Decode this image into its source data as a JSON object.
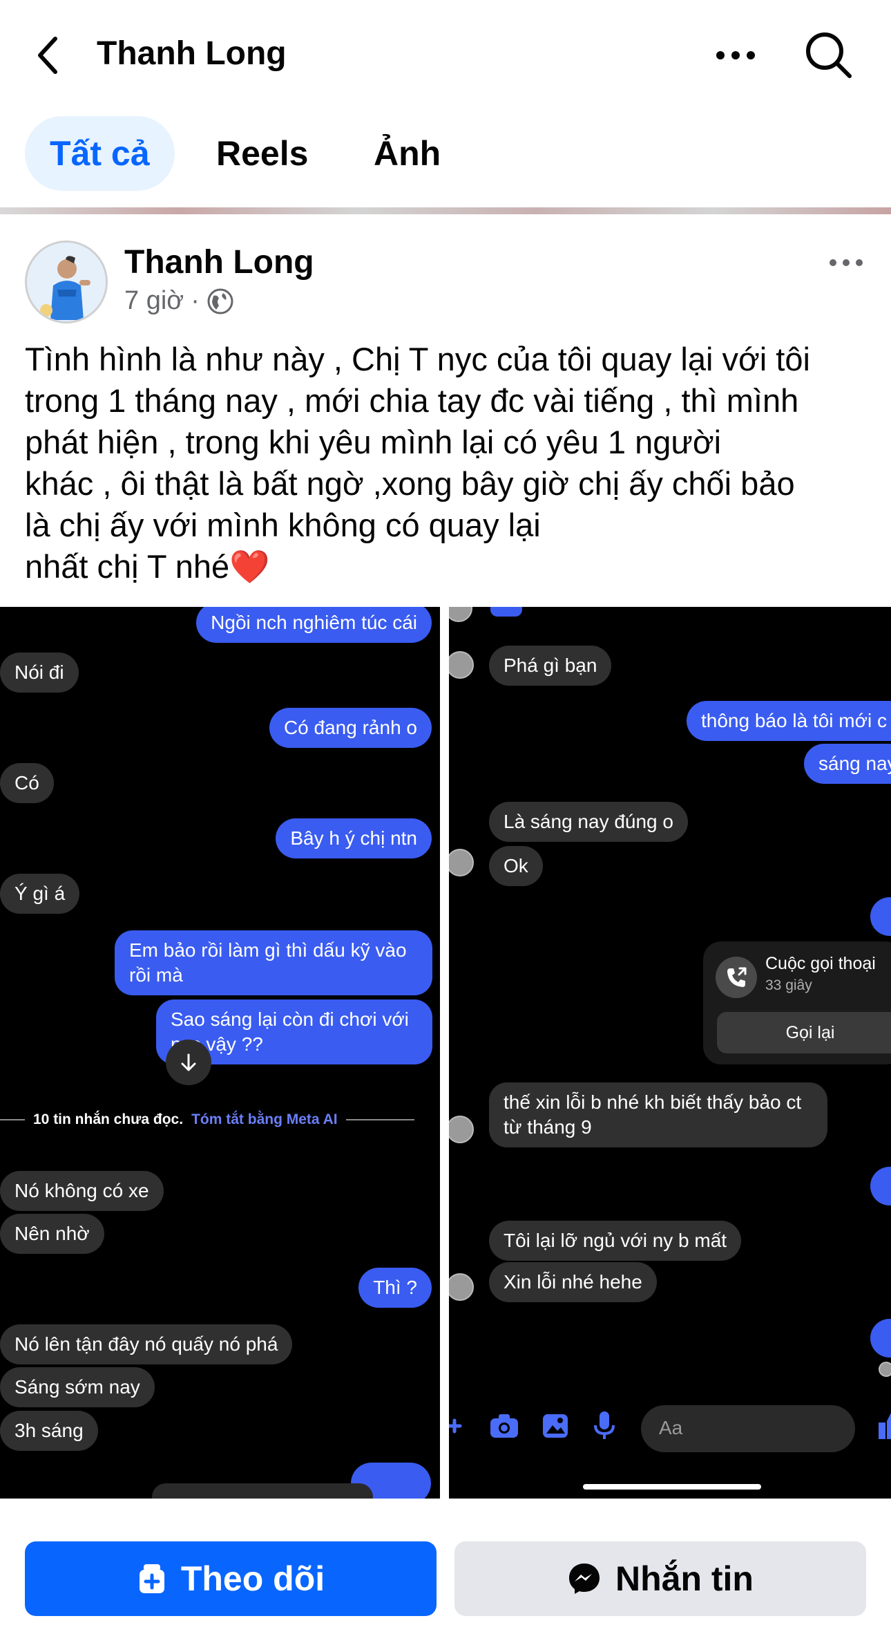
{
  "header": {
    "title": "Thanh Long"
  },
  "tabs": [
    {
      "label": "Tất cả",
      "active": true
    },
    {
      "label": "Reels",
      "active": false
    },
    {
      "label": "Ảnh",
      "active": false
    }
  ],
  "post": {
    "author": "Thanh Long",
    "time": "7 giờ",
    "separator": "·",
    "privacy_icon": "globe-icon",
    "text_lines": [
      "Tình hình là như này , Chị T nyc của tôi quay lại với tôi",
      "trong 1 tháng nay , mới chia tay đc vài tiếng , thì mình",
      "phát hiện , trong khi yêu mình lại có yêu 1 người",
      "khác , ôi thật là bất ngờ ,xong bây giờ chị ấy chối bảo",
      "là chị ấy với mình không có quay lại",
      "nhất chị T nhé❤️"
    ]
  },
  "chat_left": {
    "messages": [
      {
        "dir": "out",
        "text": "Ngồi nch nghiêm túc cái"
      },
      {
        "dir": "in",
        "text": "Nói đi"
      },
      {
        "dir": "out",
        "text": "Có đang rảnh o"
      },
      {
        "dir": "in",
        "text": "Có"
      },
      {
        "dir": "out",
        "text": "Bây h ý chị ntn"
      },
      {
        "dir": "in",
        "text": "Ý gì á"
      },
      {
        "dir": "out",
        "text": "Em bảo rồi làm gì thì dấu kỹ vào rồi mà"
      },
      {
        "dir": "out",
        "text": "Sao sáng lại còn đi chơi với nyc vậy ??"
      },
      {
        "dir": "in",
        "text": "Nó không có xe"
      },
      {
        "dir": "in",
        "text": "Nên nhờ"
      },
      {
        "dir": "out",
        "text": "Thì ?"
      },
      {
        "dir": "in",
        "text": "Nó lên tận đây nó quấy nó phá"
      },
      {
        "dir": "in",
        "text": "Sáng sớm nay"
      },
      {
        "dir": "in",
        "text": "3h sáng"
      }
    ],
    "unread_notice": "10 tin nhắn chưa đọc.",
    "meta_ai_link": "Tóm tắt bằng Meta AI"
  },
  "chat_right": {
    "messages": [
      {
        "dir": "in",
        "text": "Phá gì bạn"
      },
      {
        "dir": "out",
        "text": "thông báo là tôi mới c"
      },
      {
        "dir": "out",
        "text": "sáng nay"
      },
      {
        "dir": "in",
        "text": "Là sáng nay đúng o"
      },
      {
        "dir": "in",
        "text": "Ok"
      },
      {
        "dir": "in",
        "text": "thế xin lỗi b nhé kh biết thấy bảo ct từ tháng 9"
      },
      {
        "dir": "in",
        "text": "Tôi lại lỡ ngủ với ny b mất"
      },
      {
        "dir": "in",
        "text": "Xin lỗi nhé hehe"
      }
    ],
    "call": {
      "title": "Cuộc gọi thoại",
      "duration": "33 giây",
      "action": "Gọi lại"
    },
    "composer_placeholder": "Aa"
  },
  "actions": {
    "follow": "Theo dõi",
    "message": "Nhắn tin"
  },
  "colors": {
    "brand_blue": "#0866ff",
    "active_tab_bg": "#e7f3ff",
    "outgoing_bubble": "#3a5cf0",
    "incoming_bubble": "#303030"
  }
}
